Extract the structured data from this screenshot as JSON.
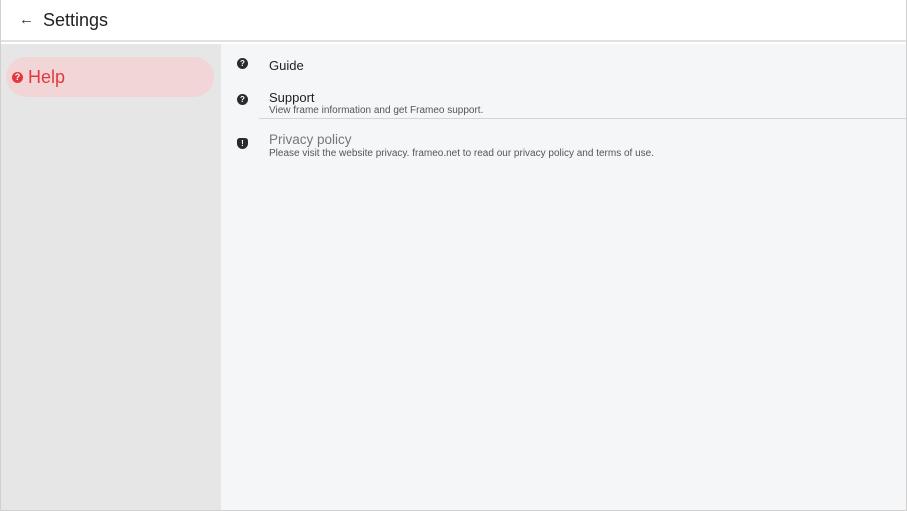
{
  "header": {
    "back_icon": "←",
    "title": "Settings"
  },
  "sidebar": {
    "items": [
      {
        "label": "Help",
        "icon": "help-circle-icon",
        "icon_glyph": "?",
        "active": true
      }
    ]
  },
  "main": {
    "items": [
      {
        "icon": "help-circle-icon",
        "icon_glyph": "?",
        "title": "Guide",
        "subtitle": ""
      },
      {
        "icon": "help-badge-icon",
        "icon_glyph": "?",
        "title": "Support",
        "subtitle": "View frame information and get Frameo support."
      },
      {
        "icon": "shield-icon",
        "icon_glyph": "!",
        "title": "Privacy policy",
        "subtitle": "Please visit the website privacy. frameo.net to read our privacy policy and terms of use."
      }
    ]
  },
  "colors": {
    "accent": "#e3393e",
    "active_bg": "#f2d6d7",
    "sidebar_bg": "#e6e6e6",
    "content_bg": "#f5f6f8"
  }
}
